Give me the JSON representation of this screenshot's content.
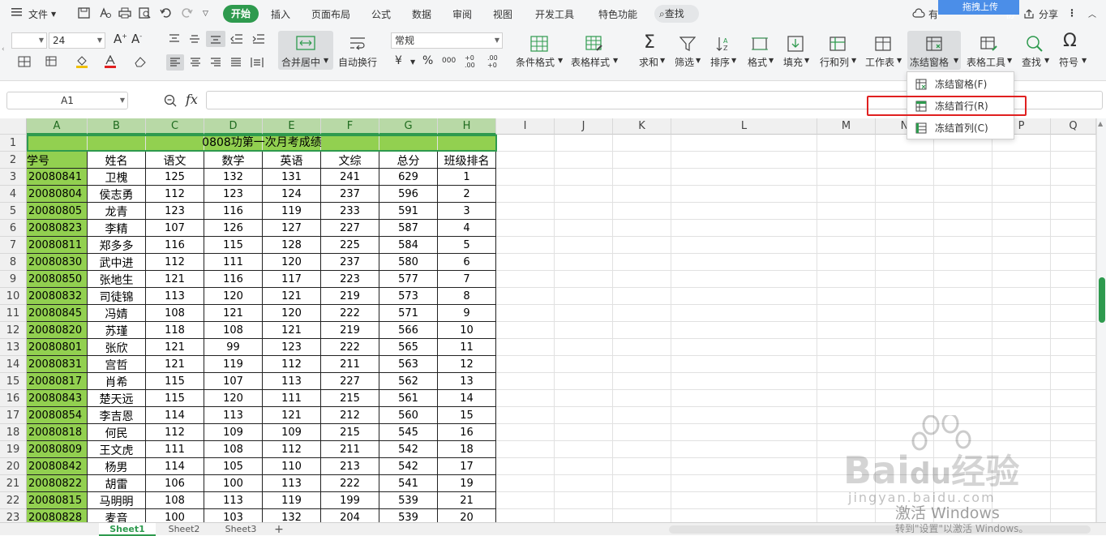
{
  "menubar": {
    "file_label": "文件",
    "tabs": [
      "开始",
      "插入",
      "页面布局",
      "公式",
      "数据",
      "审阅",
      "视图",
      "开发工具",
      "特色功能"
    ],
    "search_label": "查找",
    "right_items": [
      "有",
      "协",
      "分享"
    ],
    "upload_label": "拖拽上传",
    "accent_color": "#2e9a4e"
  },
  "ribbon": {
    "font_size": "24",
    "merge_label": "合并居中",
    "wrap_label": "自动换行",
    "number_format": "常规",
    "cond_format_label": "条件格式",
    "table_style_label": "表格样式",
    "sum_label": "求和",
    "filter_label": "筛选",
    "sort_label": "排序",
    "format_label": "格式",
    "fill_label": "填充",
    "rowcol_label": "行和列",
    "sheet_label": "工作表",
    "freeze_label": "冻结窗格",
    "tools_label": "表格工具",
    "find_label": "查找",
    "symbol_label": "符号",
    "currency_symbol": "¥",
    "percent_symbol": "%",
    "thousand_symbol": "000",
    "inc_decimal": "+0 .00",
    "dec_decimal": ".00 +0"
  },
  "formula_bar": {
    "name_box": "A1",
    "fx": "fx"
  },
  "freeze_menu": {
    "items": [
      "冻结窗格(F)",
      "冻结首行(R)",
      "冻结首列(C)"
    ],
    "highlighted": "冻结首行(R)"
  },
  "columns": [
    "A",
    "B",
    "C",
    "D",
    "E",
    "F",
    "G",
    "H",
    "I",
    "J",
    "K",
    "L",
    "M",
    "N",
    "O",
    "P",
    "Q"
  ],
  "row_numbers": [
    "1",
    "2",
    "3",
    "4",
    "5",
    "6",
    "7",
    "8",
    "9",
    "10",
    "11",
    "12",
    "13",
    "14",
    "15",
    "16",
    "17",
    "18",
    "19",
    "20",
    "21",
    "22",
    "23"
  ],
  "sheet": {
    "title": "0808功第一次月考成绩",
    "headers": [
      "学号",
      "姓名",
      "语文",
      "数学",
      "英语",
      "文综",
      "总分",
      "班级排名"
    ],
    "rows": [
      [
        "20080841",
        "卫槐",
        "125",
        "132",
        "131",
        "241",
        "629",
        "1"
      ],
      [
        "20080804",
        "侯志勇",
        "112",
        "123",
        "124",
        "237",
        "596",
        "2"
      ],
      [
        "20080805",
        "龙青",
        "123",
        "116",
        "119",
        "233",
        "591",
        "3"
      ],
      [
        "20080823",
        "李精",
        "107",
        "126",
        "127",
        "227",
        "587",
        "4"
      ],
      [
        "20080811",
        "郑多多",
        "116",
        "115",
        "128",
        "225",
        "584",
        "5"
      ],
      [
        "20080830",
        "武中进",
        "112",
        "111",
        "120",
        "237",
        "580",
        "6"
      ],
      [
        "20080850",
        "张地生",
        "121",
        "116",
        "117",
        "223",
        "577",
        "7"
      ],
      [
        "20080832",
        "司徒锦",
        "113",
        "120",
        "121",
        "219",
        "573",
        "8"
      ],
      [
        "20080845",
        "冯婧",
        "108",
        "121",
        "120",
        "222",
        "571",
        "9"
      ],
      [
        "20080820",
        "苏瑾",
        "118",
        "108",
        "121",
        "219",
        "566",
        "10"
      ],
      [
        "20080801",
        "张欣",
        "121",
        "99",
        "123",
        "222",
        "565",
        "11"
      ],
      [
        "20080831",
        "宫哲",
        "121",
        "119",
        "112",
        "211",
        "563",
        "12"
      ],
      [
        "20080817",
        "肖希",
        "115",
        "107",
        "113",
        "227",
        "562",
        "13"
      ],
      [
        "20080843",
        "楚天远",
        "115",
        "120",
        "111",
        "215",
        "561",
        "14"
      ],
      [
        "20080854",
        "李吉恩",
        "114",
        "113",
        "121",
        "212",
        "560",
        "15"
      ],
      [
        "20080818",
        "何民",
        "112",
        "109",
        "109",
        "215",
        "545",
        "16"
      ],
      [
        "20080809",
        "王文虎",
        "111",
        "108",
        "112",
        "211",
        "542",
        "18"
      ],
      [
        "20080842",
        "杨男",
        "114",
        "105",
        "110",
        "213",
        "542",
        "17"
      ],
      [
        "20080822",
        "胡雷",
        "106",
        "100",
        "113",
        "222",
        "541",
        "19"
      ],
      [
        "20080815",
        "马明明",
        "108",
        "113",
        "119",
        "199",
        "539",
        "21"
      ],
      [
        "20080828",
        "麦音",
        "100",
        "103",
        "132",
        "204",
        "539",
        "20"
      ]
    ]
  },
  "sheet_tabs": [
    "Sheet1",
    "Sheet2",
    "Sheet3"
  ],
  "watermark": {
    "brand": "Bai",
    "brand_du": "du",
    "brand_cn": "经验",
    "url": "jingyan.baidu.com",
    "activate": "激活 Windows",
    "activate_hint": "转到\"设置\"以激活 Windows。"
  }
}
